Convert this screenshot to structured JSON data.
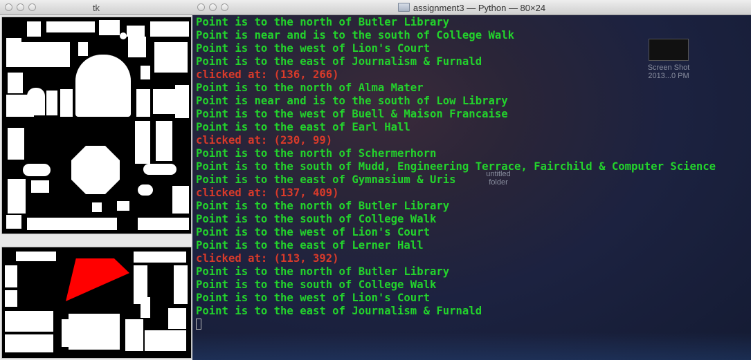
{
  "tk_window": {
    "title": "tk"
  },
  "terminal": {
    "title": "assignment3 — Python — 80×24",
    "lines": [
      {
        "text": "Point is to the north of Butler Library",
        "kind": "green"
      },
      {
        "text": "Point is near and is to the south of College Walk",
        "kind": "green"
      },
      {
        "text": "Point is to the west of Lion's Court",
        "kind": "green"
      },
      {
        "text": "Point is to the east of Journalism & Furnald",
        "kind": "green"
      },
      {
        "text": "clicked at: (136, 266)",
        "kind": "red"
      },
      {
        "text": "Point is to the north of Alma Mater",
        "kind": "green"
      },
      {
        "text": "Point is near and is to the south of Low Library",
        "kind": "green"
      },
      {
        "text": "Point is to the west of Buell & Maison Francaise",
        "kind": "green"
      },
      {
        "text": "Point is to the east of Earl Hall",
        "kind": "green"
      },
      {
        "text": "clicked at: (230, 99)",
        "kind": "red"
      },
      {
        "text": "Point is to the north of Schermerhorn",
        "kind": "green"
      },
      {
        "text": "Point is to the south of Mudd, Engineering Terrace, Fairchild & Computer Science",
        "kind": "green"
      },
      {
        "text": "Point is to the east of Gymnasium & Uris",
        "kind": "green"
      },
      {
        "text": "clicked at: (137, 409)",
        "kind": "red"
      },
      {
        "text": "Point is to the north of Butler Library",
        "kind": "green"
      },
      {
        "text": "Point is to the south of College Walk",
        "kind": "green"
      },
      {
        "text": "Point is to the west of Lion's Court",
        "kind": "green"
      },
      {
        "text": "Point is to the east of Lerner Hall",
        "kind": "green"
      },
      {
        "text": "clicked at: (113, 392)",
        "kind": "red"
      },
      {
        "text": "Point is to the north of Butler Library",
        "kind": "green"
      },
      {
        "text": "Point is to the south of College Walk",
        "kind": "green"
      },
      {
        "text": "Point is to the west of Lion's Court",
        "kind": "green"
      },
      {
        "text": "Point is to the east of Journalism & Furnald",
        "kind": "green"
      }
    ]
  },
  "desktop": {
    "screenshot_label_1": "Screen Shot",
    "screenshot_label_2": "2013...0 PM",
    "folder_label_1": "untitled",
    "folder_label_2": "folder"
  },
  "colors": {
    "terminal_green": "#23d32c",
    "terminal_red": "#d93a2a",
    "highlight_red": "#ff0000"
  },
  "icons": [
    "close-light",
    "minimize-light",
    "zoom-light",
    "folder-icon"
  ]
}
